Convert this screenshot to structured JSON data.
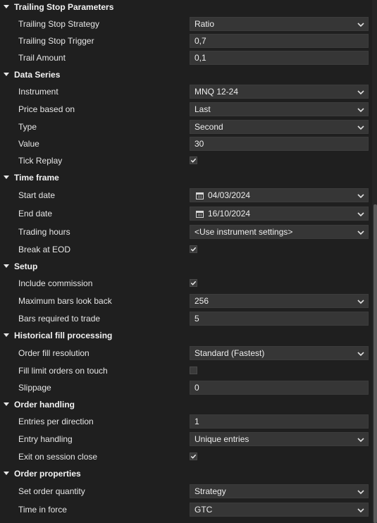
{
  "sections": {
    "trailing": {
      "title": "Trailing Stop Parameters",
      "strategy_label": "Trailing Stop Strategy",
      "strategy_value": "Ratio",
      "trigger_label": "Trailing Stop Trigger",
      "trigger_value": "0,7",
      "amount_label": "Trail Amount",
      "amount_value": "0,1"
    },
    "data_series": {
      "title": "Data Series",
      "instrument_label": "Instrument",
      "instrument_value": "MNQ 12-24",
      "price_label": "Price based on",
      "price_value": "Last",
      "type_label": "Type",
      "type_value": "Second",
      "value_label": "Value",
      "value_value": "30",
      "tick_replay_label": "Tick Replay",
      "tick_replay_checked": true
    },
    "time_frame": {
      "title": "Time frame",
      "start_label": "Start date",
      "start_value": "04/03/2024",
      "end_label": "End date",
      "end_value": "16/10/2024",
      "hours_label": "Trading hours",
      "hours_value": "<Use instrument settings>",
      "eod_label": "Break at EOD",
      "eod_checked": true
    },
    "setup": {
      "title": "Setup",
      "commission_label": "Include commission",
      "commission_checked": true,
      "bars_back_label": "Maximum bars look back",
      "bars_back_value": "256",
      "bars_required_label": "Bars required to trade",
      "bars_required_value": "5"
    },
    "fill": {
      "title": "Historical fill processing",
      "resolution_label": "Order fill resolution",
      "resolution_value": "Standard (Fastest)",
      "touch_label": "Fill limit orders on touch",
      "touch_checked": false,
      "slippage_label": "Slippage",
      "slippage_value": "0"
    },
    "order_handling": {
      "title": "Order handling",
      "entries_label": "Entries per direction",
      "entries_value": "1",
      "entry_handling_label": "Entry handling",
      "entry_handling_value": "Unique entries",
      "exit_label": "Exit on session close",
      "exit_checked": true
    },
    "order_properties": {
      "title": "Order properties",
      "quantity_label": "Set order quantity",
      "quantity_value": "Strategy",
      "tif_label": "Time in force",
      "tif_value": "GTC"
    }
  },
  "icons": {
    "chevron": "chevron-down-icon",
    "calendar": "calendar-icon",
    "check": "checkmark-icon",
    "collapse": "collapse-arrow-icon"
  },
  "colors": {
    "background": "#1f1f1f",
    "field": "#363636",
    "text": "#e8e8e8"
  }
}
